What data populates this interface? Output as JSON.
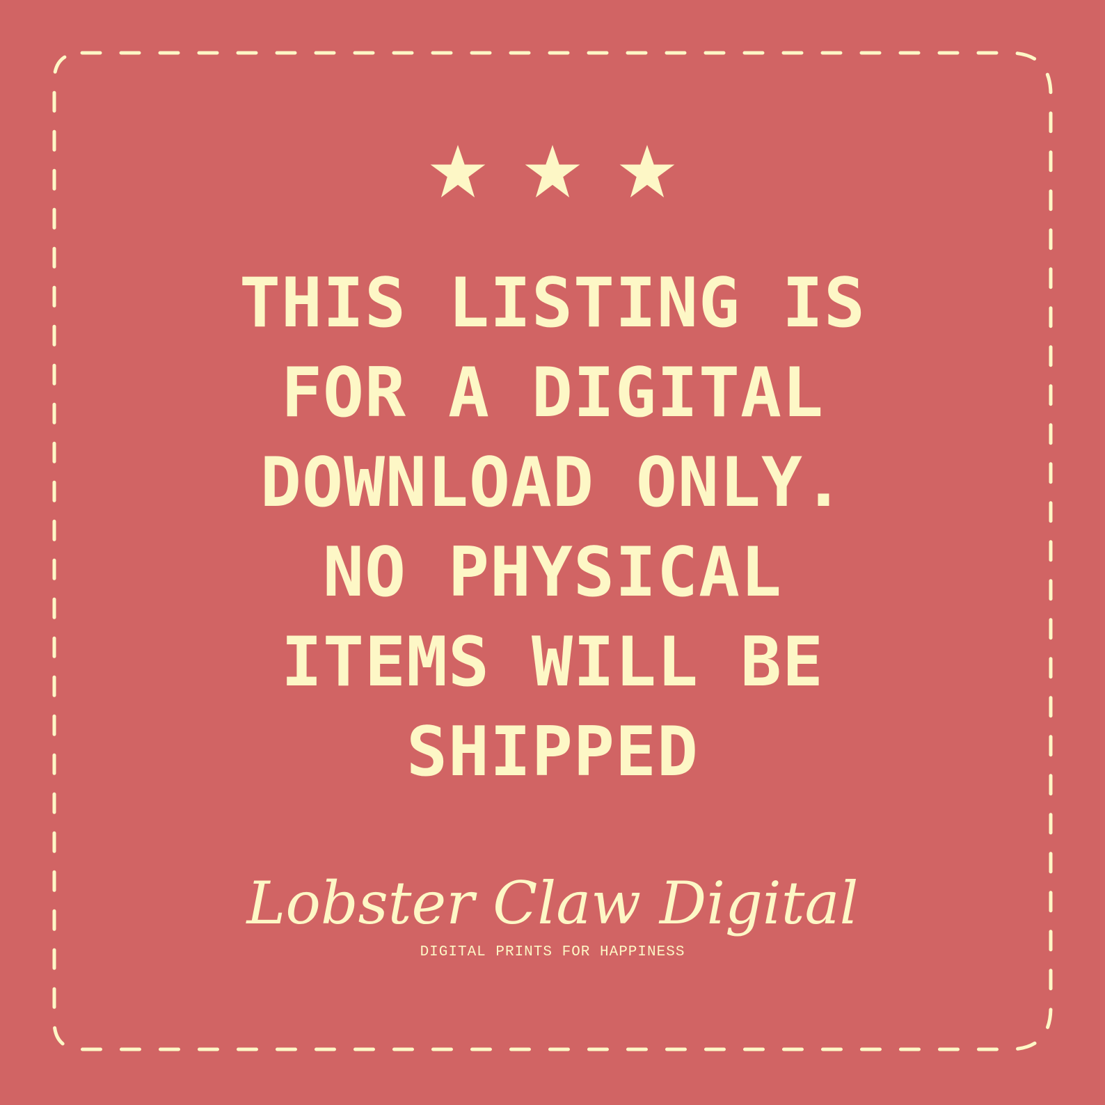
{
  "colors": {
    "background": "#d16464",
    "foreground": "#fdf7c6"
  },
  "decoration": {
    "star_count": 3,
    "star_icon": "star-icon",
    "border_style": "dashed-rounded-frame"
  },
  "message": {
    "lines": [
      "THIS LISTING IS",
      "FOR A DIGITAL",
      "DOWNLOAD ONLY.",
      "NO PHYSICAL",
      "ITEMS WILL BE",
      "SHIPPED"
    ]
  },
  "brand": {
    "name": "Lobster Claw Digital",
    "tagline": "DIGITAL PRINTS FOR HAPPINESS"
  }
}
